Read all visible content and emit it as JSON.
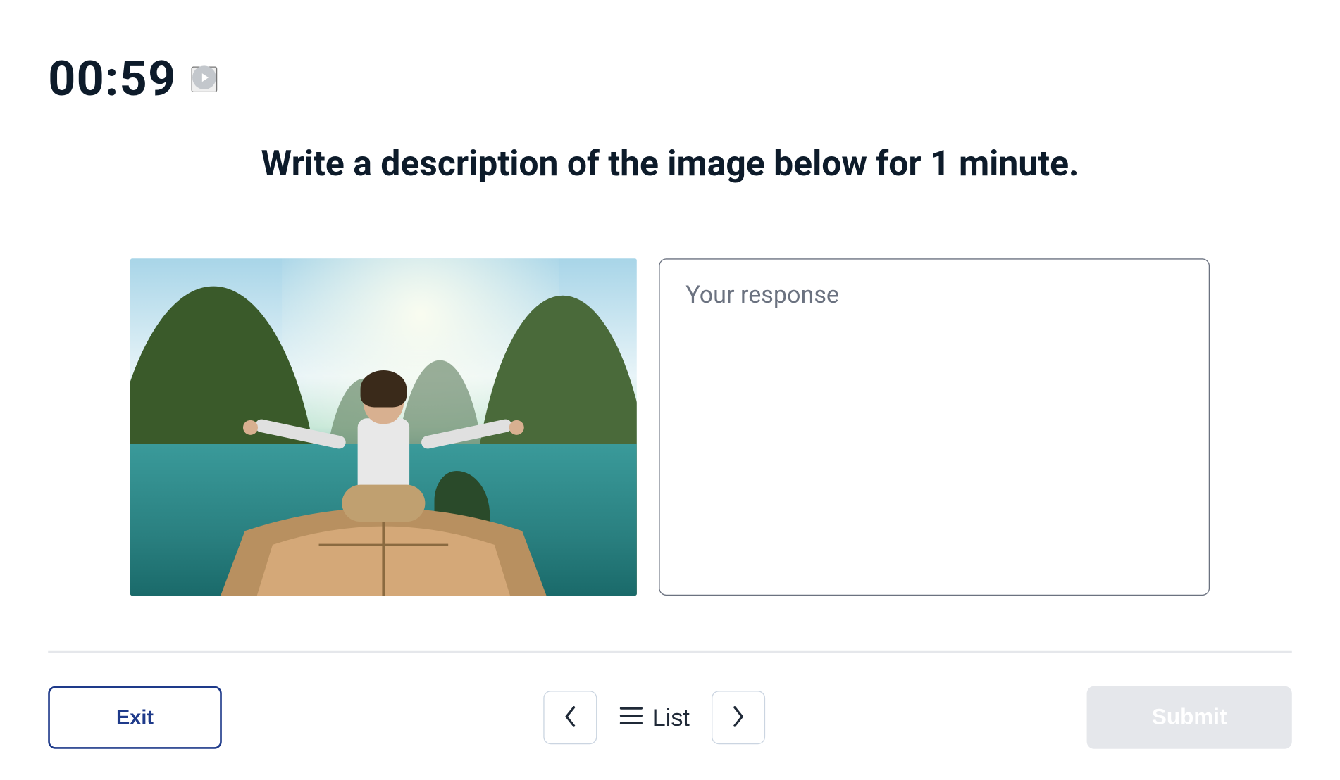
{
  "timer": {
    "value": "00:59"
  },
  "prompt": {
    "text": "Write a description of the image below for 1 minute."
  },
  "response": {
    "placeholder": "Your response",
    "value": ""
  },
  "footer": {
    "exit_label": "Exit",
    "list_label": "List",
    "submit_label": "Submit"
  },
  "icons": {
    "play": "play-circle-icon",
    "prev": "chevron-left-icon",
    "next": "chevron-right-icon",
    "list": "menu-icon"
  },
  "image": {
    "alt": "Woman sitting cross-legged with arms outstretched on the bow of a wooden longtail boat on turquoise water surrounded by tree-covered limestone karsts"
  }
}
